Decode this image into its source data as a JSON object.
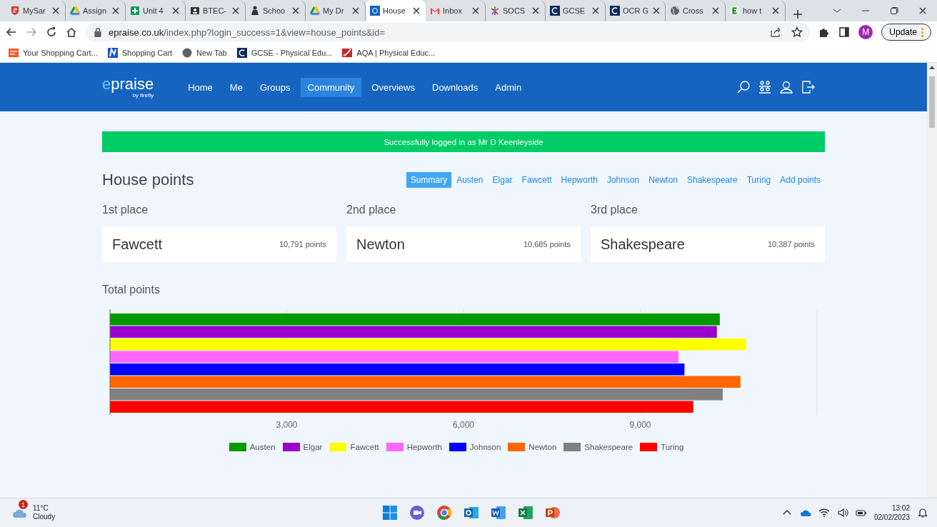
{
  "browser": {
    "tabs": [
      {
        "title": "MySar",
        "kind": "shield",
        "selected": false
      },
      {
        "title": "Assign",
        "kind": "drive",
        "selected": false
      },
      {
        "title": "Unit 4",
        "kind": "plus",
        "selected": false
      },
      {
        "title": "BTEC-",
        "kind": "board",
        "selected": false
      },
      {
        "title": "Schoo",
        "kind": "person",
        "selected": false
      },
      {
        "title": "My Dr",
        "kind": "drive",
        "selected": false
      },
      {
        "title": "House",
        "kind": "ep",
        "selected": true
      },
      {
        "title": "Inbox",
        "kind": "mail",
        "selected": false
      },
      {
        "title": "SOCS",
        "kind": "star",
        "selected": false
      },
      {
        "title": "GCSE",
        "kind": "c",
        "selected": false
      },
      {
        "title": "OCR G",
        "kind": "c",
        "selected": false
      },
      {
        "title": "Cross",
        "kind": "globe",
        "selected": false
      },
      {
        "title": "how t",
        "kind": "e",
        "selected": false
      }
    ],
    "address": {
      "domain": "epraise.co.uk",
      "path": "/index.php?login_success=1&view=house_points&id="
    },
    "profile_initial": "M",
    "update_button": "Update",
    "bookmarks": [
      {
        "label": "Your Shopping Cart...",
        "kind": "shop"
      },
      {
        "label": "Shopping Cart",
        "kind": "n"
      },
      {
        "label": "New Tab",
        "kind": "dot"
      },
      {
        "label": "GCSE - Physical Edu...",
        "kind": "c"
      },
      {
        "label": "AQA | Physical Educ...",
        "kind": "aqa"
      }
    ]
  },
  "site": {
    "logo": "epraise",
    "logo_sub": "by firefly",
    "nav": [
      {
        "label": "Home",
        "selected": false
      },
      {
        "label": "Me",
        "selected": false
      },
      {
        "label": "Groups",
        "selected": false
      },
      {
        "label": "Community",
        "selected": true
      },
      {
        "label": "Overviews",
        "selected": false
      },
      {
        "label": "Downloads",
        "selected": false
      },
      {
        "label": "Admin",
        "selected": false
      }
    ]
  },
  "alert": "Successfully logged in as Mr D Keenleyside",
  "page_title": "House points",
  "house_tabs": [
    {
      "label": "Summary",
      "selected": true
    },
    {
      "label": "Austen",
      "selected": false
    },
    {
      "label": "Elgar",
      "selected": false
    },
    {
      "label": "Fawcett",
      "selected": false
    },
    {
      "label": "Hepworth",
      "selected": false
    },
    {
      "label": "Johnson",
      "selected": false
    },
    {
      "label": "Newton",
      "selected": false
    },
    {
      "label": "Shakespeare",
      "selected": false
    },
    {
      "label": "Turing",
      "selected": false
    },
    {
      "label": "Add points",
      "selected": false
    }
  ],
  "places": [
    {
      "place": "1st place",
      "house": "Fawcett",
      "points": "10,791 points"
    },
    {
      "place": "2nd place",
      "house": "Newton",
      "points": "10,685 points"
    },
    {
      "place": "3rd place",
      "house": "Shakespeare",
      "points": "10,387 points"
    }
  ],
  "total": {
    "heading": "Total points",
    "chart_data": {
      "type": "bar",
      "orientation": "horizontal",
      "grid": true,
      "legend": "bottom",
      "xlim": [
        0,
        12000
      ],
      "xticks": [
        {
          "value": 3000,
          "label": "3,000"
        },
        {
          "value": 6000,
          "label": "6,000"
        },
        {
          "value": 9000,
          "label": "9,000"
        }
      ],
      "series": [
        {
          "name": "Austen",
          "color": "#009900",
          "values": [
            10350
          ]
        },
        {
          "name": "Elgar",
          "color": "#9900cc",
          "values": [
            10300
          ]
        },
        {
          "name": "Fawcett",
          "color": "#ffff00",
          "values": [
            10800
          ]
        },
        {
          "name": "Hepworth",
          "color": "#ff66ff",
          "values": [
            9650
          ]
        },
        {
          "name": "Johnson",
          "color": "#0000ff",
          "values": [
            9750
          ]
        },
        {
          "name": "Newton",
          "color": "#ff6600",
          "values": [
            10700
          ]
        },
        {
          "name": "Shakespeare",
          "color": "#808080",
          "values": [
            10400
          ]
        },
        {
          "name": "Turing",
          "color": "#ff0000",
          "values": [
            9900
          ]
        }
      ]
    }
  },
  "taskbar": {
    "weather": {
      "badge": "1",
      "temp": "11°C",
      "condition": "Cloudy"
    },
    "time": "13:02",
    "date": "02/02/2023"
  }
}
